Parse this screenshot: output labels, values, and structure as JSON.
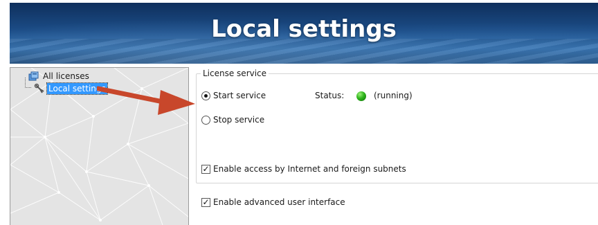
{
  "header": {
    "title": "Local settings"
  },
  "tree": {
    "items": [
      {
        "label": "All licenses",
        "icon": "licenses-icon",
        "selected": false
      },
      {
        "label": "Local settings",
        "icon": "settings-icon",
        "selected": true
      }
    ]
  },
  "license_service": {
    "group_label": "License service",
    "options": [
      {
        "label": "Start service",
        "checked": true
      },
      {
        "label": "Stop service",
        "checked": false
      }
    ],
    "status_label": "Status:",
    "status_value": "(running)",
    "status_color": "#2fb51d",
    "internet_access": {
      "label": "Enable access by Internet and foreign subnets",
      "checked": true
    }
  },
  "advanced_ui": {
    "label": "Enable advanced user interface",
    "checked": true
  },
  "annotation": {
    "arrow_color": "#c8472b"
  }
}
